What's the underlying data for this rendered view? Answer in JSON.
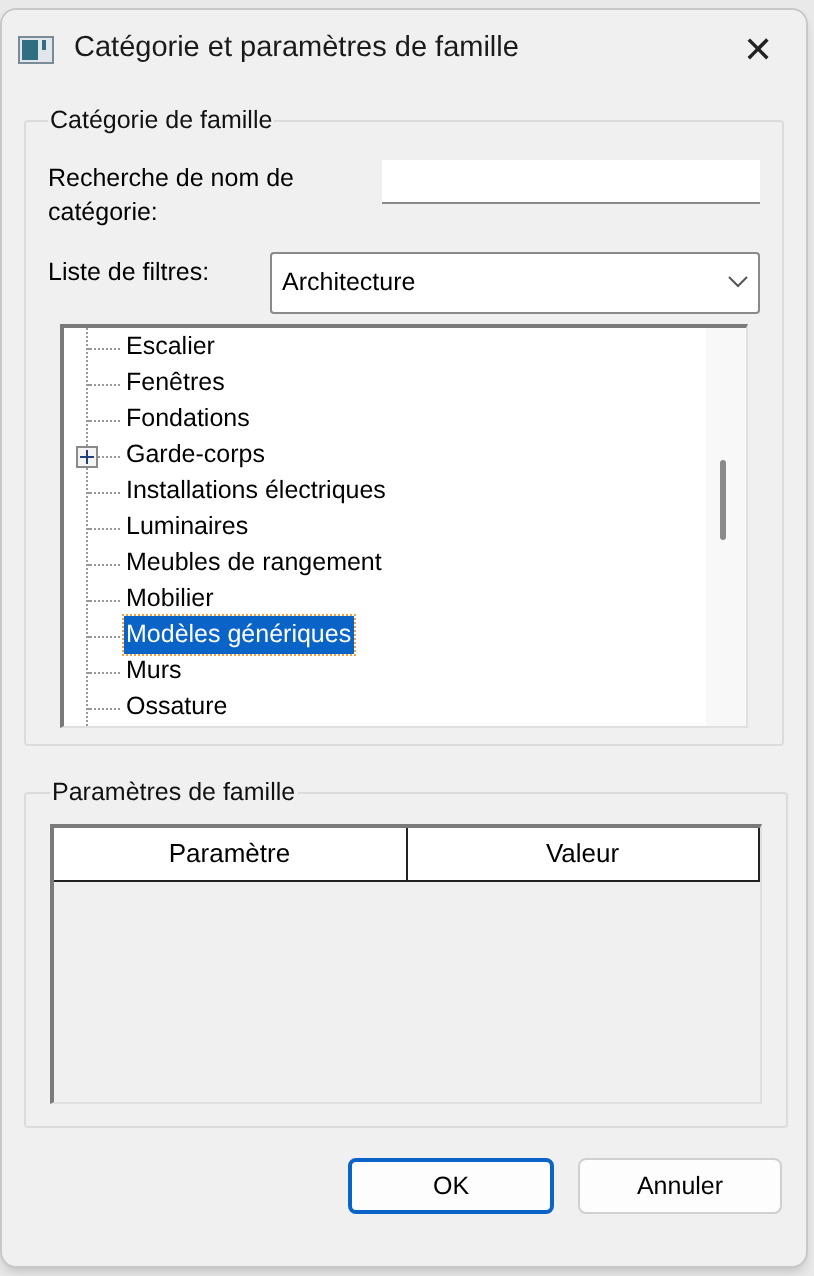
{
  "window": {
    "title": "Catégorie et paramètres de famille",
    "close": "✕"
  },
  "category_group": {
    "title": "Catégorie de famille",
    "search": {
      "label": "Recherche de nom de catégorie:"
    },
    "filter": {
      "label": "Liste de filtres:",
      "value": "Architecture"
    },
    "tree": [
      {
        "label": "Escalier",
        "kind": "leaf",
        "selected": false
      },
      {
        "label": "Fenêtres",
        "kind": "leaf",
        "selected": false
      },
      {
        "label": "Fondations",
        "kind": "leaf",
        "selected": false
      },
      {
        "label": "Garde-corps",
        "kind": "branch",
        "expanded": false,
        "selected": false
      },
      {
        "label": "Installations électriques",
        "kind": "leaf",
        "selected": false
      },
      {
        "label": "Luminaires",
        "kind": "leaf",
        "selected": false
      },
      {
        "label": "Meubles de rangement",
        "kind": "leaf",
        "selected": false
      },
      {
        "label": "Mobilier",
        "kind": "leaf",
        "selected": false
      },
      {
        "label": "Modèles génériques",
        "kind": "leaf",
        "selected": true
      },
      {
        "label": "Murs",
        "kind": "leaf",
        "selected": false
      },
      {
        "label": "Ossature",
        "kind": "leaf",
        "selected": false
      }
    ]
  },
  "parameters_group": {
    "title": "Paramètres de famille",
    "table": {
      "columns": [
        "Paramètre",
        "Valeur"
      ]
    }
  },
  "buttons": [
    {
      "label": "OK",
      "default": true
    },
    {
      "label": "Annuler",
      "default": false
    }
  ]
}
